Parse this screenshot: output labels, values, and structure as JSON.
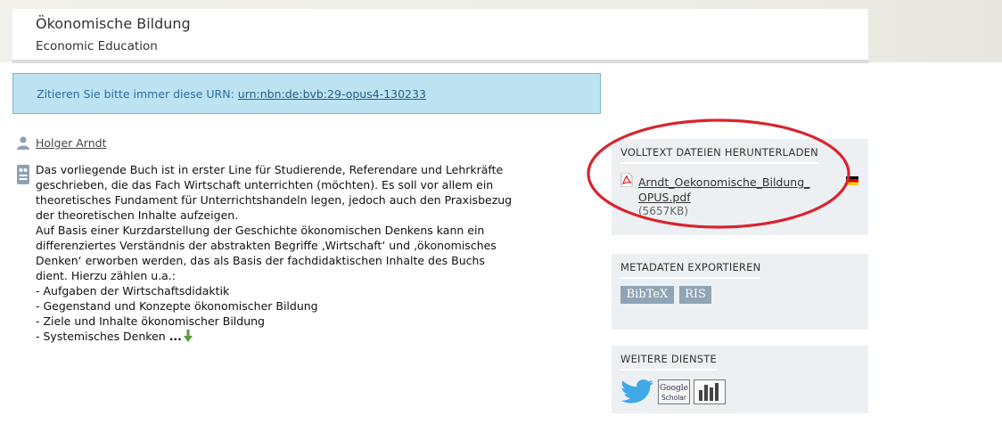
{
  "header": {
    "title": "Ökonomische Bildung",
    "subtitle": "Economic Education"
  },
  "urn": {
    "label": "Zitieren Sie bitte immer diese URN:",
    "value": "urn:nbn:de:bvb:29-opus4-130233"
  },
  "author": {
    "name": "Holger Arndt",
    "icon": "person-icon"
  },
  "abstract": {
    "icon": "abstract-icon",
    "lines": [
      "Das vorliegende Buch ist in erster Line für Studierende, Referendare und Lehrkräfte",
      "geschrieben, die das Fach Wirtschaft unterrichten (möchten). Es soll vor allem ein",
      "theoretisches Fundament für Unterrichtshandeln legen, jedoch auch den Praxisbezug",
      "der theoretischen Inhalte aufzeigen.",
      "Auf Basis einer Kurzdarstellung der Geschichte ökonomischen Denkens kann ein",
      "differenziertes Verständnis der abstrakten Begriffe ‚Wirtschaft‘ und ‚ökonomisches",
      "Denken‘ erworben werden, das als Basis der fachdidaktischen Inhalte des Buchs",
      "dient. Hierzu zählen u.a.:",
      "- Aufgaben der Wirtschaftsdidaktik",
      "- Gegenstand und Konzepte ökonomischer Bildung",
      "- Ziele und Inhalte ökonomischer Bildung",
      "- Systemisches Denken"
    ],
    "more_label": "...",
    "expand_icon": "arrow-down-icon"
  },
  "download": {
    "title": "VOLLTEXT DATEIEN HERUNTERLADEN",
    "file_name_line1": "Arndt_Oekonomische_Bildung_",
    "file_name_line2": "OPUS.pdf",
    "file_size": "(5657KB)",
    "file_icon": "pdf-icon",
    "language_icon": "flag-germany-icon"
  },
  "export": {
    "title": "METADATEN EXPORTIEREN",
    "buttons": [
      "BibTeX",
      "RIS"
    ]
  },
  "services": {
    "title": "WEITERE DIENSTE",
    "items": [
      "twitter-icon",
      "google-scholar-icon",
      "statistics-icon"
    ],
    "google_scholar_text1": "Google",
    "google_scholar_text2": "Scholar"
  },
  "colors": {
    "urn_box_bg": "#bde3f3",
    "panel_bg": "#edf0f3",
    "badge_bg": "#8fa5b5",
    "annotation_oval": "#d9232e"
  }
}
